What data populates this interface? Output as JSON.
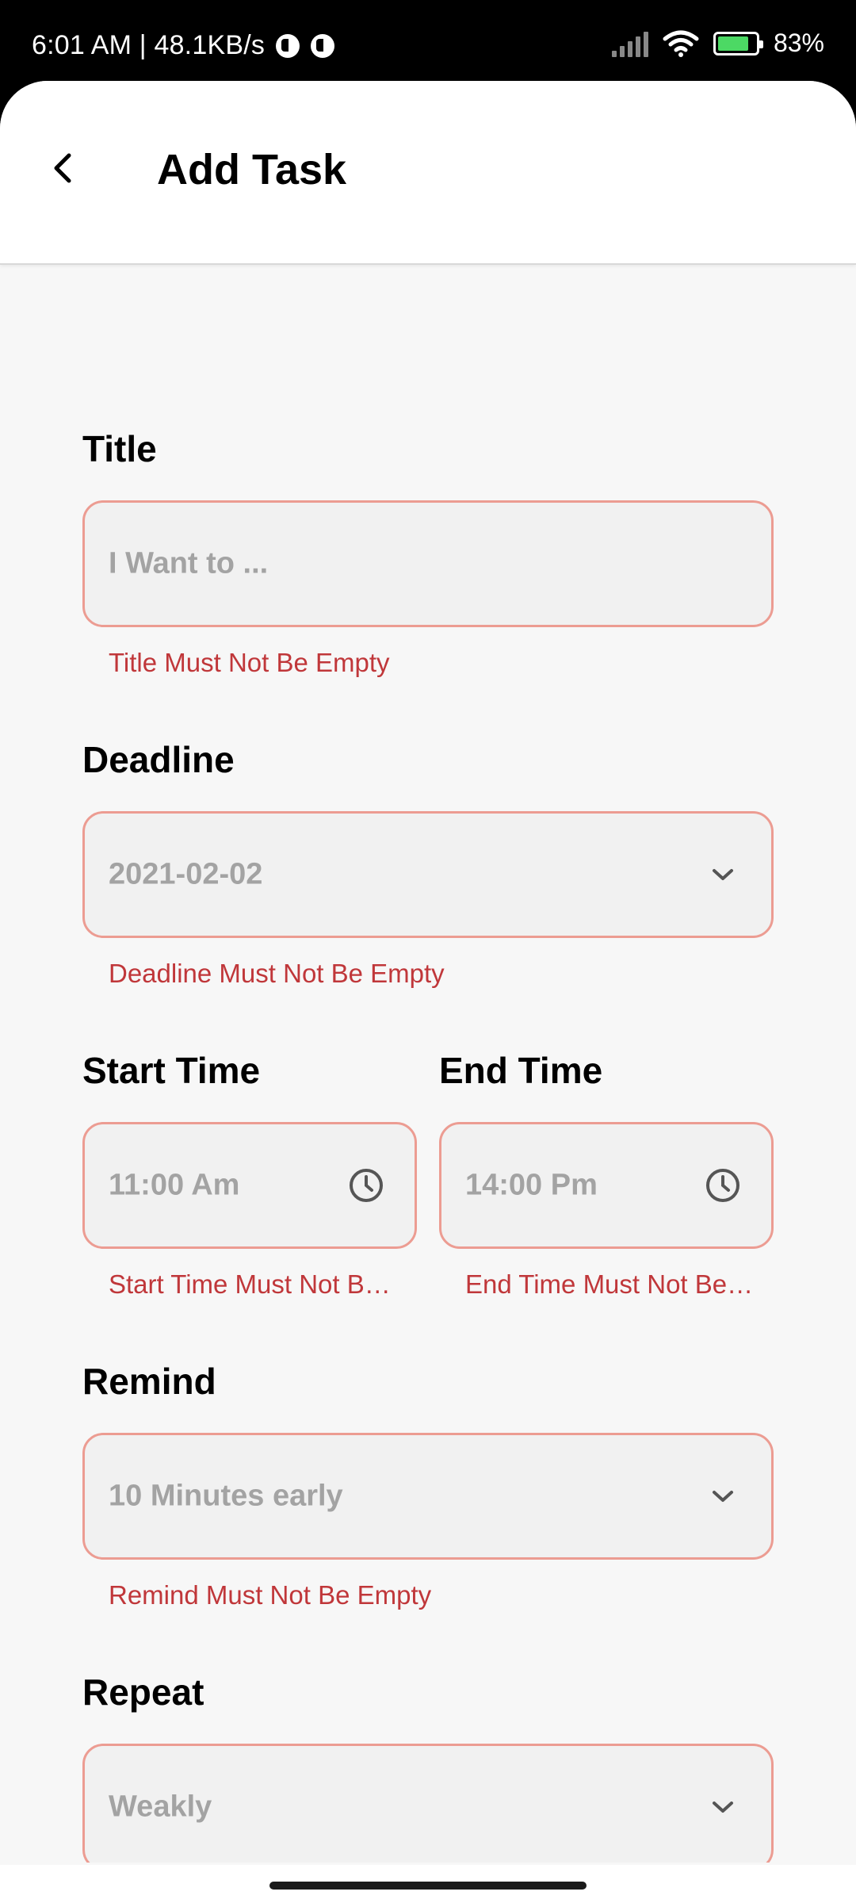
{
  "status_bar": {
    "time_speed": "6:01 AM | 48.1KB/s",
    "battery_percent": "83%",
    "icons": [
      "app-notification-icon",
      "app-notification-icon",
      "signal-icon",
      "wifi-icon",
      "battery-charging-icon"
    ]
  },
  "header": {
    "back_icon": "chevron-left-icon",
    "title": "Add Task"
  },
  "form": {
    "title": {
      "label": "Title",
      "placeholder": "I Want to ...",
      "error": "Title Must Not Be Empty"
    },
    "deadline": {
      "label": "Deadline",
      "value": "2021-02-02",
      "icon": "chevron-down-icon",
      "error": "Deadline Must Not Be Empty"
    },
    "start_time": {
      "label": "Start Time",
      "value": "11:00 Am",
      "icon": "clock-icon",
      "error": "Start Time Must Not B…"
    },
    "end_time": {
      "label": "End Time",
      "value": "14:00 Pm",
      "icon": "clock-icon",
      "error": "End Time Must Not Be…"
    },
    "remind": {
      "label": "Remind",
      "value": "10 Minutes early",
      "icon": "chevron-down-icon",
      "error": "Remind Must Not Be Empty"
    },
    "repeat": {
      "label": "Repeat",
      "value": "Weakly",
      "icon": "chevron-down-icon"
    }
  },
  "colors": {
    "field_border": "#ec9c92",
    "field_background": "#f1f1f1",
    "error_text": "#c0373a",
    "placeholder_text": "#a3a3a3",
    "page_background": "#f7f7f7"
  }
}
